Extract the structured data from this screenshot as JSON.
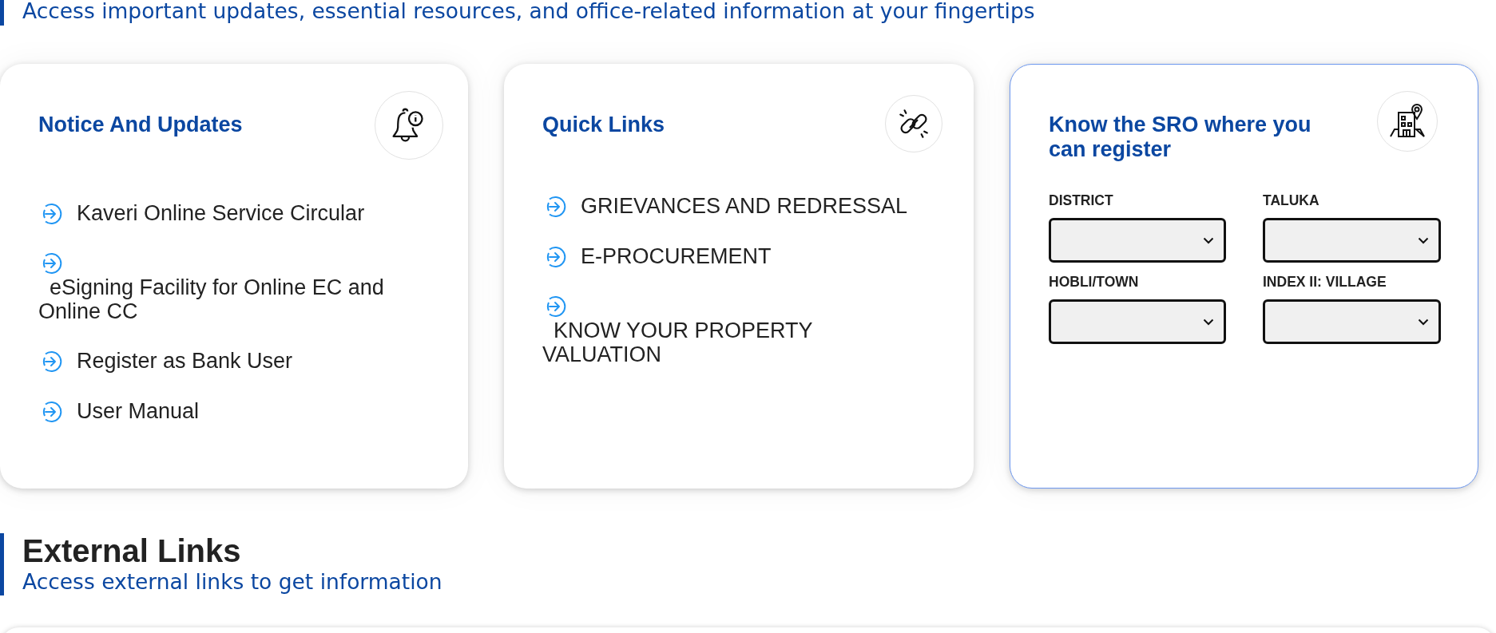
{
  "section_subtitle": "Access important updates, essential resources, and office-related information at your fingertips",
  "cards": [
    {
      "kind": "links",
      "title": "Notice And Updates",
      "highlighted": false,
      "items": [
        {
          "label": "Kaveri Online Service Circular",
          "kind": "inline"
        },
        {
          "label": "eSigning Facility for Online EC and Online CC",
          "kind": "stacked"
        },
        {
          "label": "Register as Bank User",
          "kind": "inline"
        },
        {
          "label": "User Manual",
          "kind": "inline"
        }
      ]
    },
    {
      "kind": "links",
      "title": "Quick Links",
      "highlighted": false,
      "items": [
        {
          "label": "GRIEVANCES AND REDRESSAL",
          "kind": "inline"
        },
        {
          "label": "E-PROCUREMENT",
          "kind": "inline"
        },
        {
          "label": "KNOW YOUR PROPERTY VALUATION",
          "kind": "stacked"
        }
      ]
    },
    {
      "kind": "form",
      "title": "Know the SRO where you can register",
      "highlighted": true,
      "fields": [
        {
          "label": "DISTRICT"
        },
        {
          "label": "TALUKA"
        },
        {
          "label": "HOBLI/TOWN"
        },
        {
          "label": "INDEX II: VILLAGE"
        }
      ]
    }
  ],
  "external_links": {
    "title": "External Links",
    "subtitle": "Access external links to get information"
  }
}
